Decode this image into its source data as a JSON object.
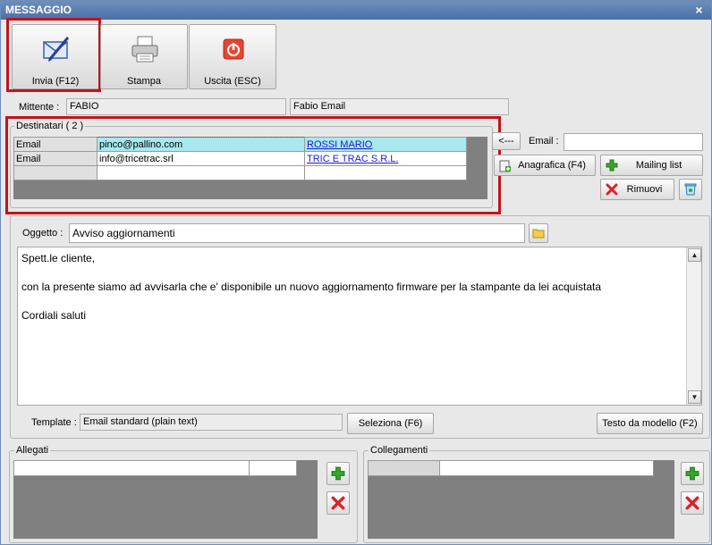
{
  "window": {
    "title": "MESSAGGIO",
    "close_glyph": "×"
  },
  "toolbar": {
    "send_label": "Invia (F12)",
    "print_label": "Stampa",
    "exit_label": "Uscita (ESC)"
  },
  "sender": {
    "label": "Mittente :",
    "name": "FABIO",
    "account": "Fabio Email"
  },
  "recipients": {
    "title": "Destinatari ( 2 )",
    "rows": [
      {
        "type": "Email",
        "address": "pinco@pallino.com",
        "name": "ROSSI MARIO"
      },
      {
        "type": "Email",
        "address": "info@tricetrac.srl",
        "name": "TRIC E TRAC S.R.L."
      }
    ],
    "arrow_button": "<---",
    "email_label": "Email :",
    "email_value": "",
    "anagrafica_button": "Anagrafica (F4)",
    "mailing_button": "Mailing list",
    "remove_button": "Rimuovi"
  },
  "message": {
    "subject_label": "Oggetto :",
    "subject_value": "Avviso aggiornamenti",
    "body_lines": [
      "Spett.le cliente,",
      "con la presente siamo ad avvisarla che e' disponibile un nuovo aggiornamento firmware per la stampante da lei acquistata",
      "Cordiali saluti"
    ],
    "template_label": "Template :",
    "template_value": "Email standard (plain text)",
    "select_button": "Seleziona (F6)",
    "template_text_button": "Testo da modello (F2)"
  },
  "attachments": {
    "title": "Allegati"
  },
  "links": {
    "title": "Collegamenti"
  },
  "colors": {
    "highlight": "#c0141b",
    "selected_cell": "#a8e8ef",
    "link_text": "#1a1ad4",
    "add_green": "#3aa52c",
    "delete_red": "#d8232a"
  }
}
